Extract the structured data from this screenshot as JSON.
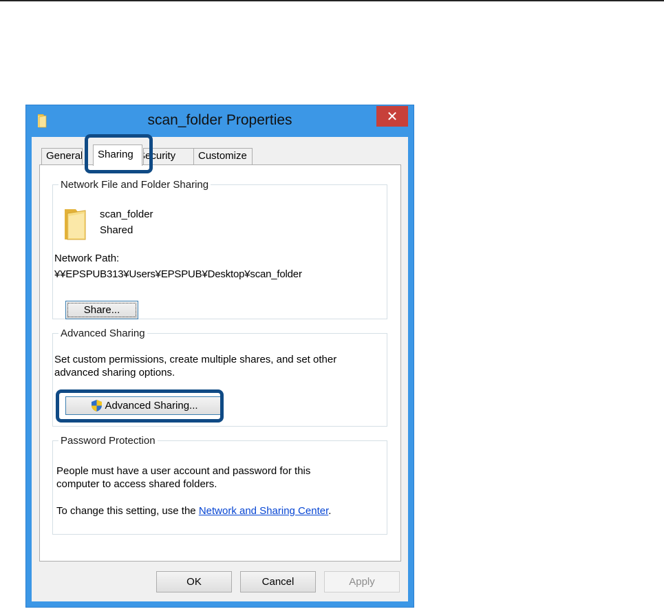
{
  "window": {
    "title": "scan_folder Properties",
    "close_glyph": "✕",
    "accent_color": "#3c97e6"
  },
  "tabs": [
    {
      "label": "General"
    },
    {
      "label": "Sharing",
      "selected": true
    },
    {
      "label": "Security"
    },
    {
      "label": "Customize"
    }
  ],
  "network_sharing": {
    "legend": "Network File and Folder Sharing",
    "folder_name": "scan_folder",
    "status": "Shared",
    "path_label": "Network Path:",
    "path_value": "¥¥EPSPUB313¥Users¥EPSPUB¥Desktop¥scan_folder",
    "share_button": "Share..."
  },
  "advanced_sharing": {
    "legend": "Advanced Sharing",
    "description_line1": "Set custom permissions, create multiple shares, and set other",
    "description_line2": "advanced sharing options.",
    "button_label": "Advanced Sharing...",
    "button_icon": "uac-shield-icon"
  },
  "password_protection": {
    "legend": "Password Protection",
    "line1": "People must have a user account and password for this",
    "line2": "computer to access shared folders.",
    "change_prefix": "To change this setting, use the ",
    "link_text": "Network and Sharing Center",
    "change_suffix": "."
  },
  "footer": {
    "ok": "OK",
    "cancel": "Cancel",
    "apply": "Apply"
  }
}
